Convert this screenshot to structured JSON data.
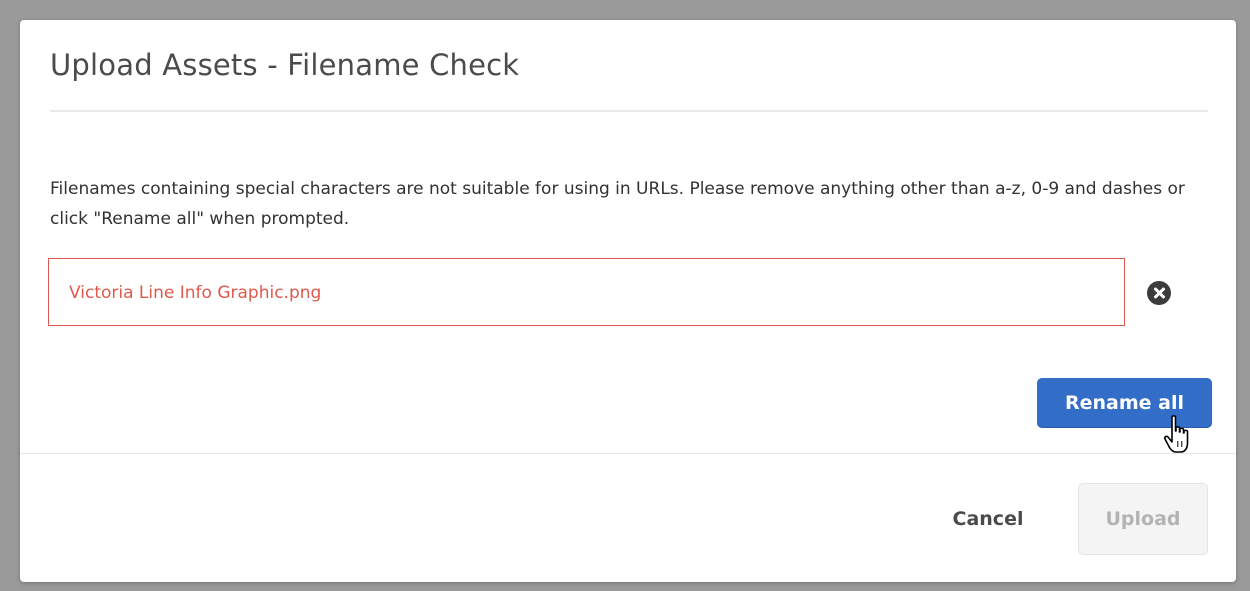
{
  "dialog": {
    "title": "Upload Assets - Filename Check",
    "message": "Filenames containing special characters are not suitable for using in URLs. Please remove anything other than a-z, 0-9 and dashes or click \"Rename all\" when prompted.",
    "files": [
      {
        "name": "Victoria Line Info Graphic.png",
        "error": true
      }
    ],
    "rename_all_label": "Rename all",
    "cancel_label": "Cancel",
    "upload_label": "Upload",
    "upload_enabled": false
  },
  "icons": {
    "remove_file": "close-circle-icon",
    "cursor": "hand-pointer-icon"
  },
  "colors": {
    "overlay": "#9a9a9a",
    "error": "#e0594c",
    "primary": "#326ec8",
    "disabled_text": "#b3b3b3"
  }
}
